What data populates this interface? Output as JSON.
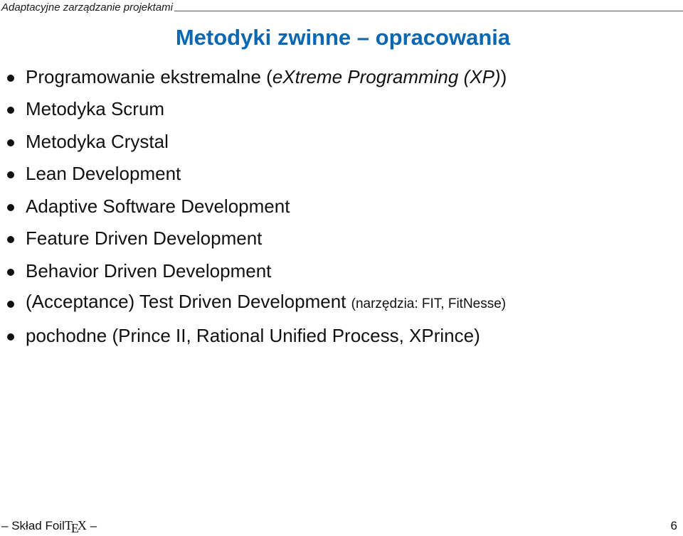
{
  "header": {
    "title": "Adaptacyjne zarządzanie projektami"
  },
  "slide": {
    "title": "Metodyki zwinne – opracowania",
    "title_color": "#0b67b2"
  },
  "items": [
    {
      "prefix": "Programowanie ekstremalne (",
      "emphasis": "eXtreme Programming (XP)",
      "suffix": ")"
    },
    {
      "text": "Metodyka Scrum"
    },
    {
      "text": "Metodyka Crystal"
    },
    {
      "text": "Lean Development"
    },
    {
      "text": "Adaptive Software Development"
    },
    {
      "text": "Feature Driven Development"
    },
    {
      "text": "Behavior Driven Development"
    },
    {
      "text": "(Acceptance) Test Driven Development",
      "note": "(narzędzia: FIT, FitNesse)"
    },
    {
      "text": "pochodne (Prince II, Rational Unified Process, XPrince)"
    }
  ],
  "footer": {
    "dash_left": "–",
    "label": "Skład Foil",
    "tex_t": "T",
    "tex_e": "E",
    "tex_x": "X",
    "dash_right": "–",
    "page_number": "6"
  },
  "icons": {
    "bullet": "bullet-dot-icon"
  }
}
